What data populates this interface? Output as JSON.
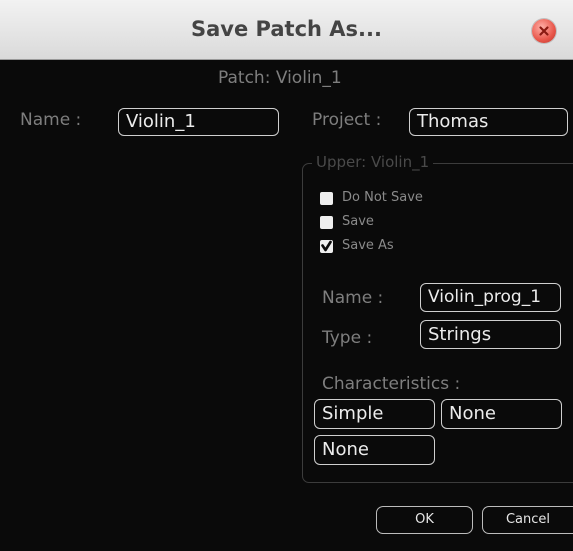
{
  "dialog": {
    "title": "Save Patch As...",
    "patch_caption": "Patch: Violin_1"
  },
  "patch": {
    "name_label": "Name :",
    "name_value": "Violin_1",
    "project_label": "Project :",
    "project_value": "Thomas"
  },
  "upper": {
    "legend": "Upper: Violin_1",
    "options": [
      {
        "label": "Do Not Save",
        "checked": false
      },
      {
        "label": "Save",
        "checked": false
      },
      {
        "label": "Save As",
        "checked": true
      }
    ],
    "name_label": "Name :",
    "name_value": "Violin_prog_1",
    "type_label": "Type :",
    "type_value": "Strings",
    "characteristics_label": "Characteristics :",
    "characteristics": [
      "Simple",
      "None",
      "None"
    ]
  },
  "buttons": {
    "ok": "OK",
    "cancel": "Cancel"
  },
  "colors": {
    "background": "#0a0a0a",
    "titlebar": "#e4e4e4",
    "close_button": "#e8564a",
    "field_border": "#cfcfcf"
  },
  "icons": {
    "close": "close-icon",
    "checkmark": "checkmark-icon"
  }
}
